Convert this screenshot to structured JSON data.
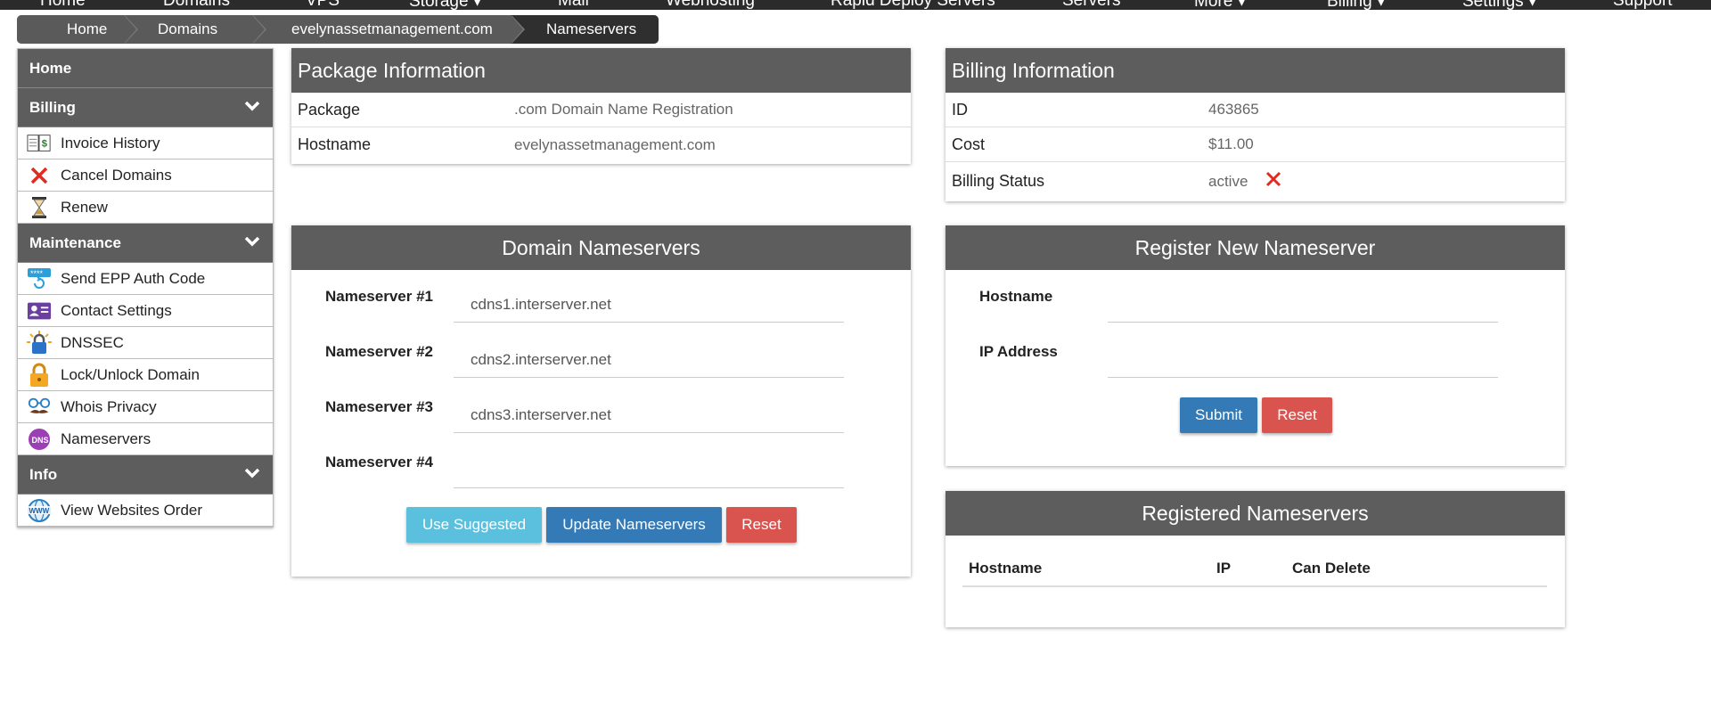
{
  "topnav": {
    "items": [
      "Home",
      "Domains",
      "VPS",
      "Storage ▾",
      "Mail",
      "Webhosting",
      "Rapid Deploy Servers",
      "Servers",
      "More ▾",
      "Billing ▾",
      "Settings ▾",
      "Support"
    ]
  },
  "breadcrumb": [
    "Home",
    "Domains",
    "evelynassetmanagement.com",
    "Nameservers"
  ],
  "sidebar": {
    "home": "Home",
    "billing": {
      "title": "Billing",
      "items": [
        {
          "label": "Invoice History",
          "icon": "invoice-book-icon"
        },
        {
          "label": "Cancel Domains",
          "icon": "red-x-icon"
        },
        {
          "label": "Renew",
          "icon": "hourglass-icon"
        }
      ]
    },
    "maintenance": {
      "title": "Maintenance",
      "items": [
        {
          "label": "Send EPP Auth Code",
          "icon": "password-refresh-icon"
        },
        {
          "label": "Contact Settings",
          "icon": "contact-card-icon"
        },
        {
          "label": "DNSSEC",
          "icon": "dnssec-lock-icon"
        },
        {
          "label": "Lock/Unlock Domain",
          "icon": "padlock-icon"
        },
        {
          "label": "Whois Privacy",
          "icon": "disguise-glasses-icon"
        },
        {
          "label": "Nameservers",
          "icon": "dns-badge-icon"
        }
      ]
    },
    "info": {
      "title": "Info",
      "items": [
        {
          "label": "View Websites Order",
          "icon": "www-globe-icon"
        }
      ]
    }
  },
  "package_info": {
    "title": "Package Information",
    "rows": [
      {
        "label": "Package",
        "value": ".com Domain Name Registration"
      },
      {
        "label": "Hostname",
        "value": "evelynassetmanagement.com"
      }
    ]
  },
  "billing_info": {
    "title": "Billing Information",
    "rows": [
      {
        "label": "ID",
        "value": "463865"
      },
      {
        "label": "Cost",
        "value": "$11.00"
      },
      {
        "label": "Billing Status",
        "value": "active"
      }
    ]
  },
  "domain_nameservers": {
    "title": "Domain Nameservers",
    "fields": [
      {
        "label": "Nameserver #1",
        "value": "cdns1.interserver.net"
      },
      {
        "label": "Nameserver #2",
        "value": "cdns2.interserver.net"
      },
      {
        "label": "Nameserver #3",
        "value": "cdns3.interserver.net"
      },
      {
        "label": "Nameserver #4",
        "value": ""
      }
    ],
    "buttons": {
      "suggested": "Use Suggested",
      "update": "Update Nameservers",
      "reset": "Reset"
    }
  },
  "register_nameserver": {
    "title": "Register New Nameserver",
    "fields": [
      {
        "label": "Hostname",
        "value": ""
      },
      {
        "label": "IP Address",
        "value": ""
      }
    ],
    "buttons": {
      "submit": "Submit",
      "reset": "Reset"
    }
  },
  "registered_nameservers": {
    "title": "Registered Nameservers",
    "columns": [
      "Hostname",
      "IP",
      "Can Delete"
    ]
  },
  "colors": {
    "panel_header": "#5d5d5d",
    "primary": "#337ab7",
    "info": "#5bc0de",
    "danger": "#d9534f"
  }
}
